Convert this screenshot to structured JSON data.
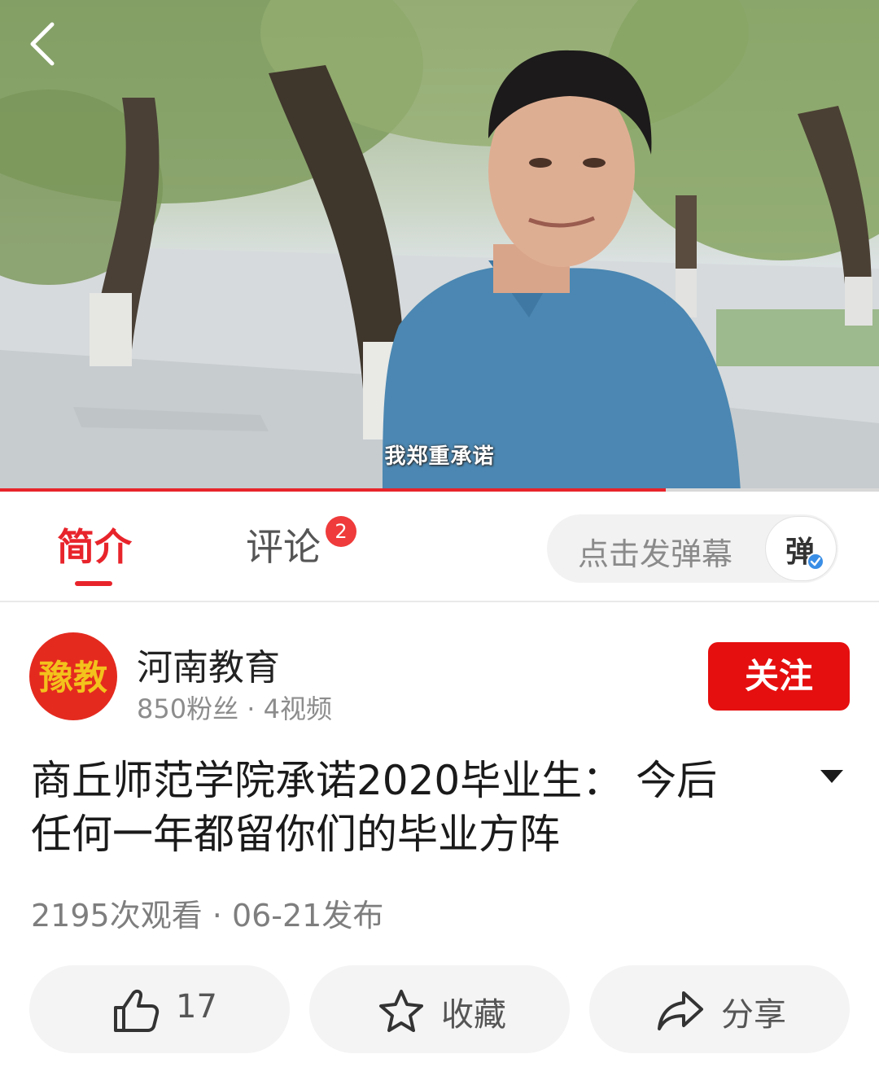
{
  "video": {
    "subtitle": "我郑重承诺",
    "progress_fraction": 0.757
  },
  "tabs": {
    "intro_label": "简介",
    "comments_label": "评论",
    "comments_badge": "2",
    "danmaku_placeholder": "点击发弹幕",
    "danmaku_button": "弹"
  },
  "channel": {
    "avatar_text": "豫教",
    "name": "河南教育",
    "meta": "850粉丝 · 4视频",
    "follow_label": "关注"
  },
  "details": {
    "title_line1": "商丘师范学院承诺2020毕业生：  今后",
    "title_line2": "任何一年都留你们的毕业方阵",
    "stats": "2195次观看 · 06-21发布"
  },
  "actions": {
    "like_count": "17",
    "favorite_label": "收藏",
    "share_label": "分享"
  },
  "colors": {
    "accent_red": "#e8242b",
    "follow_red": "#e60f0f",
    "badge_red": "#ef3b3b",
    "avatar_red": "#e42a1f",
    "avatar_gold": "#f3c21c",
    "shirt_blue": "#4b87b2"
  }
}
